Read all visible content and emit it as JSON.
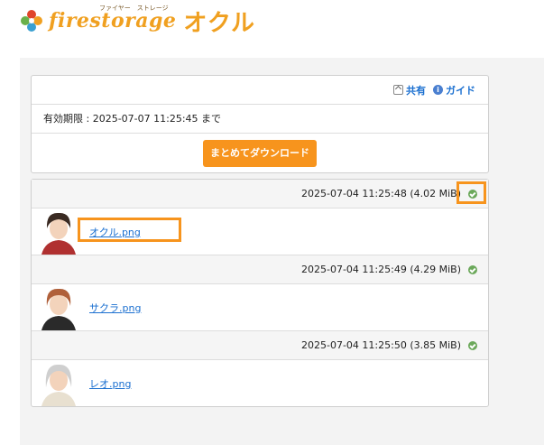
{
  "logo": {
    "text": "firestorage",
    "sub": "ファイヤー　ストレージ",
    "jp": "オクル"
  },
  "toolbar": {
    "share_label": "共有",
    "guide_label": "ガイド"
  },
  "expiry": {
    "text": "有効期限 : 2025-07-07 11:25:45 まで"
  },
  "download_all": {
    "label": "まとめてダウンロード"
  },
  "files": [
    {
      "meta": "2025-07-04 11:25:48 (4.02 MiB)",
      "name": "オクル.png",
      "hair_color": "#3a2a22",
      "shirt_color": "#b03030"
    },
    {
      "meta": "2025-07-04 11:25:49 (4.29 MiB)",
      "name": "サクラ.png",
      "hair_color": "#b0603a",
      "shirt_color": "#2a2a2a"
    },
    {
      "meta": "2025-07-04 11:25:50 (3.85 MiB)",
      "name": "レオ.png",
      "hair_color": "#cfcfcf",
      "shirt_color": "#e8e0d0"
    }
  ],
  "colors": {
    "accent": "#f7941d",
    "link": "#1a6fd0"
  }
}
